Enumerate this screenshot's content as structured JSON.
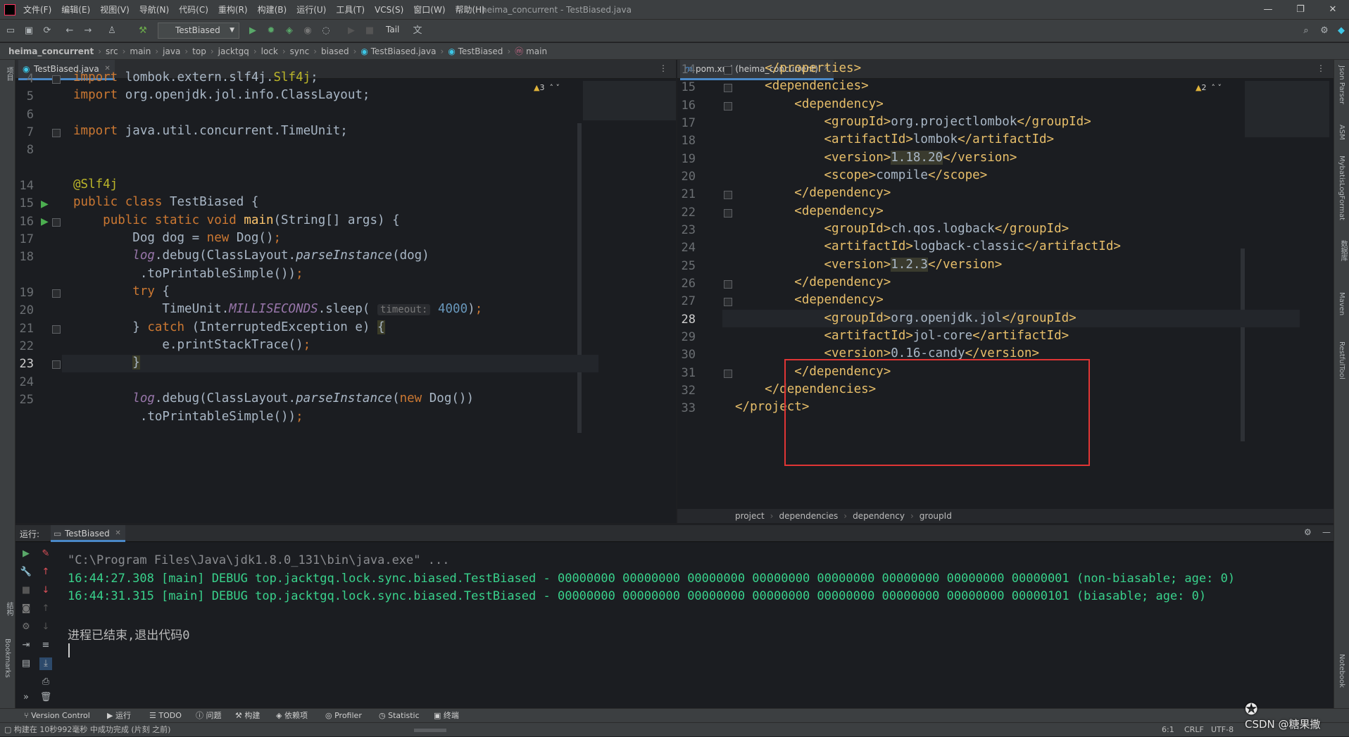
{
  "window": {
    "title": "heima_concurrent - TestBiased.java",
    "menu": [
      "文件(F)",
      "编辑(E)",
      "视图(V)",
      "导航(N)",
      "代码(C)",
      "重构(R)",
      "构建(B)",
      "运行(U)",
      "工具(T)",
      "VCS(S)",
      "窗口(W)",
      "帮助(H)"
    ],
    "controls": {
      "minimize": "—",
      "restore": "❐",
      "close": "✕"
    }
  },
  "toolbar": {
    "run_config": "TestBiased",
    "tail_label": "Tail"
  },
  "breadcrumb": [
    "heima_concurrent",
    "src",
    "main",
    "java",
    "top",
    "jacktgq",
    "lock",
    "sync",
    "biased",
    "TestBiased.java",
    "TestBiased",
    "main"
  ],
  "left_strip": {
    "project_label": "项目",
    "structure_label": "结构",
    "bookmarks_label": "Bookmarks"
  },
  "right_strip": [
    "Json Parser",
    "ASM",
    "MybatisLogFormat",
    "数据库",
    "Maven",
    "RestfulTool",
    "Notebook"
  ],
  "editor_left": {
    "tab": "TestBiased.java",
    "warnings": "3",
    "lines": [
      {
        "num": "4",
        "text": "import lombok.extern.slf4j.Slf4j;"
      },
      {
        "num": "5",
        "text": "import org.openjdk.jol.info.ClassLayout;"
      },
      {
        "num": "6",
        "text": ""
      },
      {
        "num": "7",
        "text": "import java.util.concurrent.TimeUnit;"
      },
      {
        "num": "8",
        "text": ""
      },
      {
        "num": "14",
        "text": "@Slf4j"
      },
      {
        "num": "15",
        "text": "public class TestBiased {"
      },
      {
        "num": "16",
        "text": "    public static void main(String[] args) {"
      },
      {
        "num": "17",
        "text": "        Dog dog = new Dog();"
      },
      {
        "num": "18",
        "text": "        log.debug(ClassLayout.parseInstance(dog)"
      },
      {
        "num": "",
        "text": "         .toPrintableSimple());"
      },
      {
        "num": "19",
        "text": "        try {"
      },
      {
        "num": "20",
        "text": "            TimeUnit.MILLISECONDS.sleep( timeout: 4000);"
      },
      {
        "num": "21",
        "text": "        } catch (InterruptedException e) {"
      },
      {
        "num": "22",
        "text": "            e.printStackTrace();"
      },
      {
        "num": "23",
        "text": "        }"
      },
      {
        "num": "24",
        "text": ""
      },
      {
        "num": "25",
        "text": "        log.debug(ClassLayout.parseInstance(new Dog())"
      },
      {
        "num": "",
        "text": "         .toPrintableSimple());"
      }
    ]
  },
  "editor_right": {
    "tab": "pom.xml (heima_concurrent)",
    "warnings": "2",
    "lines": [
      {
        "num": "14",
        "text": "    </properties>"
      },
      {
        "num": "15",
        "text": "    <dependencies>"
      },
      {
        "num": "16",
        "text": "        <dependency>"
      },
      {
        "num": "17",
        "text": "            <groupId>org.projectlombok</groupId>"
      },
      {
        "num": "18",
        "text": "            <artifactId>lombok</artifactId>"
      },
      {
        "num": "19",
        "text": "            <version>1.18.20</version>"
      },
      {
        "num": "20",
        "text": "            <scope>compile</scope>"
      },
      {
        "num": "21",
        "text": "        </dependency>"
      },
      {
        "num": "22",
        "text": "        <dependency>"
      },
      {
        "num": "23",
        "text": "            <groupId>ch.qos.logback</groupId>"
      },
      {
        "num": "24",
        "text": "            <artifactId>logback-classic</artifactId>"
      },
      {
        "num": "25",
        "text": "            <version>1.2.3</version>"
      },
      {
        "num": "26",
        "text": "        </dependency>"
      },
      {
        "num": "27",
        "text": "        <dependency>"
      },
      {
        "num": "28",
        "text": "            <groupId>org.openjdk.jol</groupId>"
      },
      {
        "num": "29",
        "text": "            <artifactId>jol-core</artifactId>"
      },
      {
        "num": "30",
        "text": "            <version>0.16-candy</version>"
      },
      {
        "num": "31",
        "text": "        </dependency>"
      },
      {
        "num": "32",
        "text": "    </dependencies>"
      },
      {
        "num": "33",
        "text": "</project>"
      }
    ],
    "crumbs": [
      "project",
      "dependencies",
      "dependency",
      "groupId"
    ]
  },
  "run_panel": {
    "label": "运行:",
    "tab": "TestBiased",
    "output": [
      "\"C:\\Program Files\\Java\\jdk1.8.0_131\\bin\\java.exe\" ...",
      "16:44:27.308 [main] DEBUG top.jacktgq.lock.sync.biased.TestBiased - 00000000 00000000 00000000 00000000 00000000 00000000 00000000 00000001 (non-biasable; age: 0)",
      "16:44:31.315 [main] DEBUG top.jacktgq.lock.sync.biased.TestBiased - 00000000 00000000 00000000 00000000 00000000 00000000 00000000 00000101 (biasable; age: 0)",
      "",
      "进程已结束,退出代码0"
    ]
  },
  "bottom_tools": [
    "Version Control",
    "运行",
    "TODO",
    "问题",
    "构建",
    "依赖项",
    "Profiler",
    "Statistic",
    "终端"
  ],
  "status": {
    "message": "构建在 10秒992毫秒 中成功完成 (片刻 之前)",
    "position": "6:1",
    "line_sep": "CRLF",
    "encoding": "UTF-8"
  },
  "watermark": "CSDN @糖果撒"
}
